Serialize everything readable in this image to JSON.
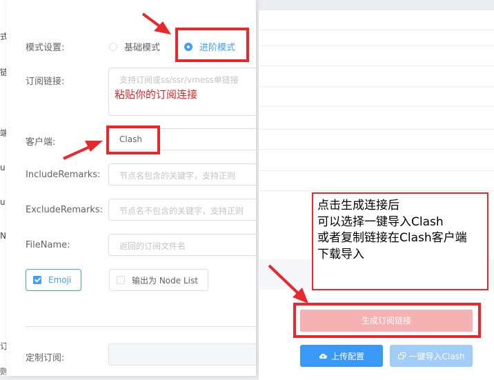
{
  "background_page": {
    "edge_chars": [
      "式",
      "链",
      "端",
      "u",
      "u",
      "N",
      "订",
      "则"
    ]
  },
  "form": {
    "mode_label": "模式设置:",
    "mode_options": [
      "基础模式",
      "进阶模式"
    ],
    "mode_selected": "进阶模式",
    "subscribe_label": "订阅链接:",
    "subscribe_placeholder": "支持订阅或ss/ssr/vmess单链接",
    "client_label": "客户端:",
    "client_value": "Clash",
    "include_label": "IncludeRemarks:",
    "include_placeholder": "节点名包含的关键字，支持正则",
    "exclude_label": "ExcludeRemarks:",
    "exclude_placeholder": "节点名不包含的关键字，支持正则",
    "filename_label": "FileName:",
    "filename_placeholder": "返回的订阅文件名",
    "emoji_label": "Emoji",
    "emoji_checked": true,
    "nodelist_label": "输出为 Node List",
    "nodelist_checked": false,
    "custom_label": "定制订阅:"
  },
  "actions": {
    "generate_label": "生成订阅链接",
    "upload_label": "上传配置",
    "import_label": "一键导入Clash"
  },
  "annotations": {
    "paste_hint": "粘贴你的订阅连接",
    "note_lines": [
      "点击生成连接后",
      "可以选择一键导入Clash",
      "或者复制链接在Clash客户端",
      "下载导入"
    ],
    "highlight_color": "#e8282b"
  },
  "colors": {
    "primary": "#409eff",
    "danger_light": "#f6b2b2",
    "upload_button": "#3a99f7",
    "import_button": "#a3cdf9"
  }
}
